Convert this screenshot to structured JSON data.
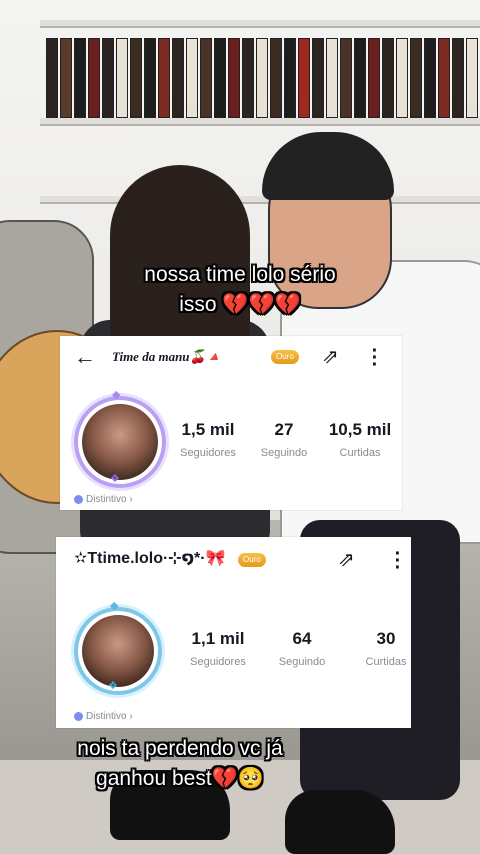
{
  "captions": {
    "top_line1": "nossa time lolo sério",
    "top_line2": "isso 💔💔💔",
    "bottom_line1": "nois ta perdendo vc já",
    "bottom_line2": "ganhou best💔🥺"
  },
  "profiles": [
    {
      "username": "Time da manu🍒🔺",
      "badge": "Ouro",
      "stats": [
        {
          "value": "1,5 mil",
          "label": "Seguidores"
        },
        {
          "value": "27",
          "label": "Seguindo"
        },
        {
          "value": "10,5 mil",
          "label": "Curtidas"
        }
      ],
      "distintivo": "Distintivo ›"
    },
    {
      "username": "✫Ttime.lolo·⊹໑*·🎀",
      "badge": "Ouro",
      "stats": [
        {
          "value": "1,1 mil",
          "label": "Seguidores"
        },
        {
          "value": "64",
          "label": "Seguindo"
        },
        {
          "value": "30",
          "label": "Curtidas"
        }
      ],
      "distintivo": "Distintivo ›"
    }
  ],
  "icons": {
    "back": "←",
    "share": "⇗",
    "more": "⋮"
  },
  "colors": {
    "badge_gold": "#e39a17",
    "caption_text": "#ffffff",
    "stat_label": "#8a8b91"
  }
}
